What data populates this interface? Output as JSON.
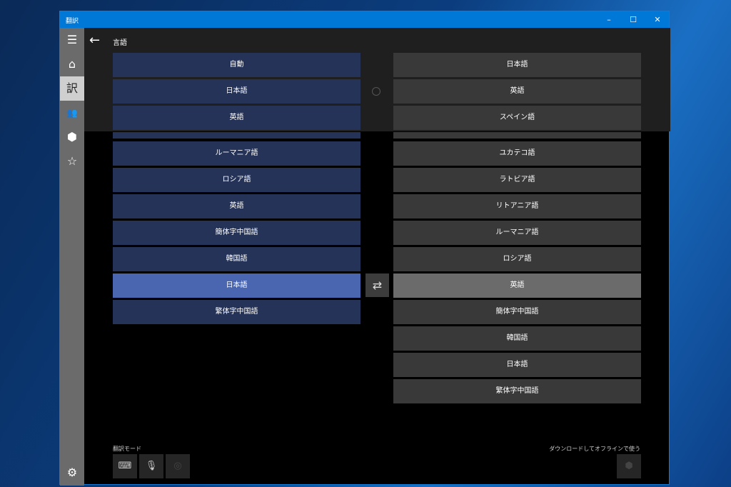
{
  "window": {
    "title": "翻訳",
    "minimize": "–",
    "maximize": "☐",
    "close": "✕"
  },
  "sidebar": {
    "menu": "☰",
    "home": "⌂",
    "translate": "訳",
    "conversation": "👥",
    "offline": "⬢",
    "favorites": "☆",
    "settings": "⚙"
  },
  "header": {
    "back": "←",
    "title": "言語"
  },
  "left_recent": [
    "自動",
    "日本語",
    "英語"
  ],
  "right_recent": [
    "日本語",
    "英語",
    "スペイン語"
  ],
  "left_list": [
    "ルーマニア語",
    "ロシア語",
    "英語",
    "簡体字中国語",
    "韓国語",
    "日本語",
    "繁体字中国語"
  ],
  "left_selected": "日本語",
  "right_list": [
    "ユカテコ語",
    "ラトビア語",
    "リトアニア語",
    "ルーマニア語",
    "ロシア語",
    "英語",
    "簡体字中国語",
    "韓国語",
    "日本語",
    "繁体字中国語"
  ],
  "right_selected": "英語",
  "swap": "⇄",
  "footer": {
    "mode_label": "翻訳モード",
    "keyboard": "⌨",
    "mic": "🎙",
    "camera": "◎",
    "offline_label": "ダウンロードしてオフラインで使う",
    "offline_icon": "⬢"
  },
  "colors": {
    "accent": "#0078d7",
    "left_row": "#253358",
    "left_selected": "#4a66b0",
    "right_row": "#393939",
    "right_selected": "#6b6b6b"
  }
}
